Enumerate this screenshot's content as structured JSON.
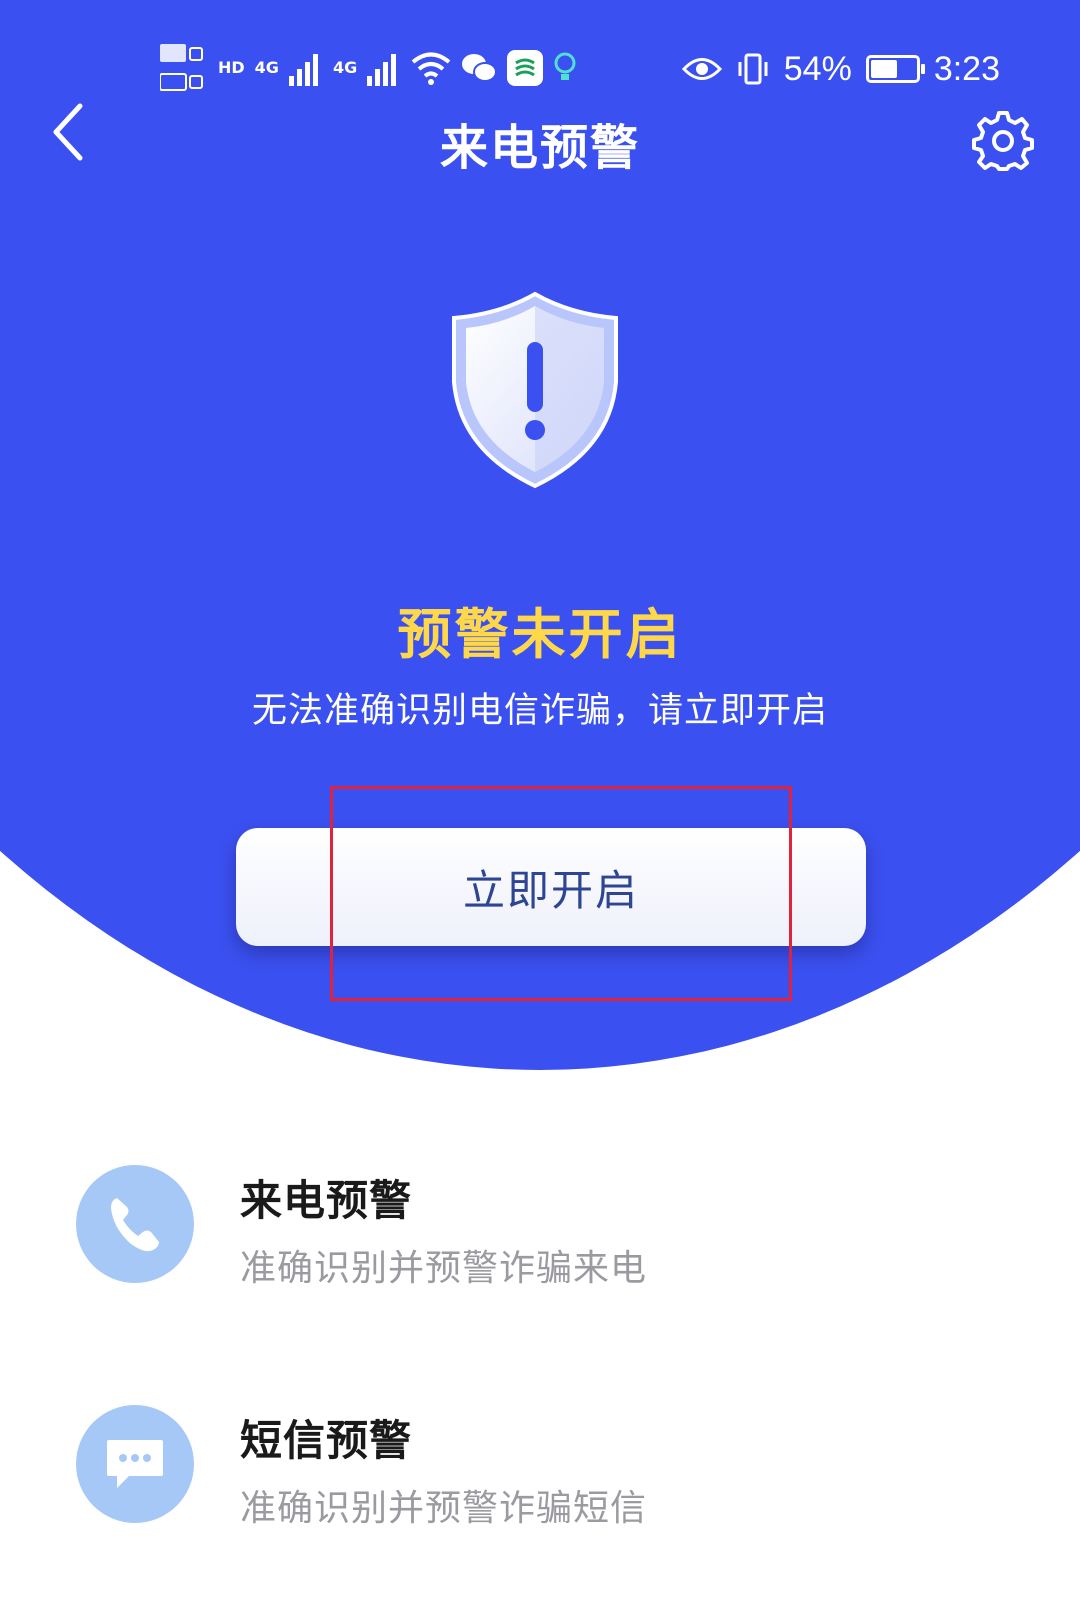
{
  "colors": {
    "primary_blue": "#3b50f0",
    "warning_yellow": "#ffd84a",
    "highlight_red": "#e0233c",
    "feature_icon_bg": "#a6c8f7"
  },
  "status_bar": {
    "hd_label": "HD",
    "net1": "4G",
    "net2": "4G",
    "battery": "54%",
    "time": "3:23"
  },
  "header": {
    "title": "来电预警",
    "back_icon": "chevron-left-icon",
    "settings_icon": "gear-icon"
  },
  "hero": {
    "status_title": "预警未开启",
    "status_desc": "无法准确识别电信诈骗，请立即开启",
    "enable_button": "立即开启"
  },
  "features": [
    {
      "icon": "phone-icon",
      "title": "来电预警",
      "desc": "准确识别并预警诈骗来电"
    },
    {
      "icon": "message-icon",
      "title": "短信预警",
      "desc": "准确识别并预警诈骗短信"
    }
  ]
}
